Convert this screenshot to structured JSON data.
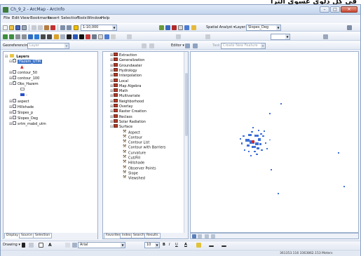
{
  "banner": {
    "text": "في كل دلوي عسوي الترا"
  },
  "window": {
    "title": "Ch_9_2 - ArcMap - ArcInfo",
    "controls": {
      "min": "–",
      "max": "□",
      "close": "✕"
    }
  },
  "menu": [
    "File",
    "Edit",
    "View",
    "Bookmarks",
    "Insert",
    "Selection",
    "Tools",
    "Window",
    "Help"
  ],
  "toolbar": {
    "scale": "1:10,000",
    "spatial_analyst_label": "Spatial Analyst ▾",
    "layer_label": "Layer:",
    "layer_value": "Slopes_Deg",
    "georeferencing_label": "Georeferencing ▾",
    "layer_combo_placeholder": "Layer",
    "editor_label": "Editor ▾",
    "task_label": "Task",
    "task_value": "Create New Feature",
    "zoom_combo": "",
    "effect_combo": ""
  },
  "toc": {
    "root": "Layers",
    "items": [
      {
        "label": "Hazem_UTM",
        "checked": true,
        "selected": true,
        "indent": 1
      },
      {
        "label": "contour_50",
        "checked": false,
        "indent": 1
      },
      {
        "label": "contour_100",
        "checked": false,
        "indent": 1
      },
      {
        "label": "Obs_Hazem",
        "checked": true,
        "indent": 1
      },
      {
        "label": "aspect",
        "checked": false,
        "indent": 1
      },
      {
        "label": "Hillshade",
        "checked": false,
        "indent": 1
      },
      {
        "label": "Slopes_p",
        "checked": false,
        "indent": 1
      },
      {
        "label": "Slopes_Deg",
        "checked": false,
        "indent": 1
      },
      {
        "label": "srtm_mabd_utm",
        "checked": false,
        "indent": 1
      }
    ],
    "sublegend": [
      "",
      "-"
    ],
    "tabs": [
      "Display",
      "Source",
      "Selection"
    ]
  },
  "catalog": {
    "toolsets": [
      "Extraction",
      "Generalization",
      "Groundwater",
      "Hydrology",
      "Interpolation",
      "Local",
      "Map Algebra",
      "Math",
      "Multivariate",
      "Neighborhood",
      "Overlay",
      "Raster Creation",
      "Reclass",
      "Solar Radiation",
      "Surface"
    ],
    "surface_tools": [
      "Aspect",
      "Contour",
      "Contour List",
      "Contour with Barriers",
      "Curvature",
      "Cut/Fill",
      "Hillshade",
      "Observer Points",
      "Slope",
      "Viewshed"
    ],
    "tabs": [
      "Favorites",
      "Index",
      "Search",
      "Results"
    ]
  },
  "drawing": {
    "label": "Drawing ▾",
    "text_tool": "A",
    "font": "Arial",
    "size": "10",
    "bold": "B",
    "italic": "I",
    "underline": "U"
  },
  "status": {
    "coords": "361353.116  3363862.153 Meters"
  },
  "colors": {
    "map_blue": "#3e6fd8",
    "map_red": "#d42a2a",
    "selection": "#3b74c9"
  }
}
